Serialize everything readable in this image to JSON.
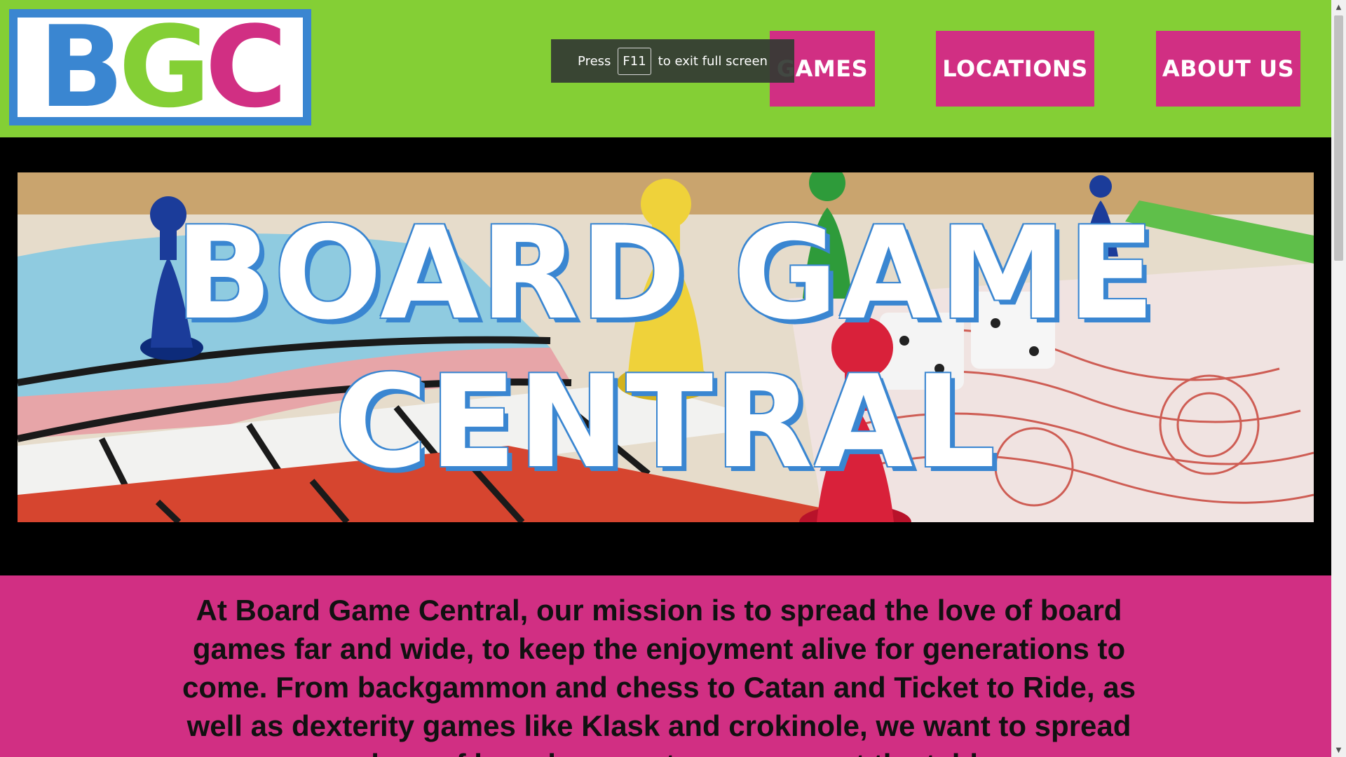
{
  "header": {
    "logo": {
      "letters": [
        "B",
        "G",
        "C"
      ]
    },
    "nav": [
      {
        "label": "GAMES"
      },
      {
        "label": "LOCATIONS"
      },
      {
        "label": "ABOUT US"
      }
    ]
  },
  "fullscreen_toast": {
    "prefix": "Press",
    "key": "F11",
    "suffix": "to exit full screen"
  },
  "hero": {
    "title_line1": "BOARD GAME",
    "title_line2": "CENTRAL"
  },
  "mission": {
    "text": "At Board Game Central, our mission is to spread the love of board games far and wide, to keep the enjoyment alive for generations to come. From backgammon and chess to Catan and Ticket to Ride, as well as dexterity games like Klask and crokinole, we want to spread our love of board games to everyone at the table."
  },
  "colors": {
    "header_green": "#84cf35",
    "brand_blue": "#3a86d1",
    "brand_pink": "#d12f83",
    "hero_band": "#000000"
  }
}
